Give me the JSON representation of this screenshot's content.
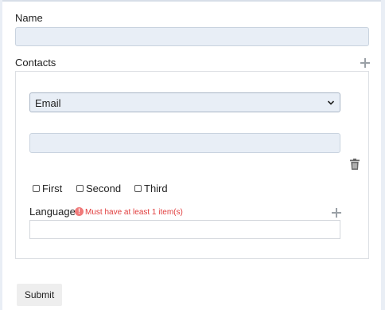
{
  "form": {
    "name_label": "Name",
    "name_value": "",
    "contacts_label": "Contacts",
    "contact": {
      "type_value": "Email",
      "type_options": [
        "Email"
      ],
      "value": "",
      "options": [
        {
          "label": "First",
          "checked": false
        },
        {
          "label": "Second",
          "checked": false
        },
        {
          "label": "Third",
          "checked": false
        }
      ],
      "language_label": "Language",
      "language_error_badge": "!",
      "language_error": "Must have at least 1 item(s)",
      "language_value": ""
    },
    "submit_label": "Submit"
  },
  "colors": {
    "field_bg": "#e8eef6",
    "error": "#e03c3c",
    "error_badge": "#f07a7a"
  }
}
